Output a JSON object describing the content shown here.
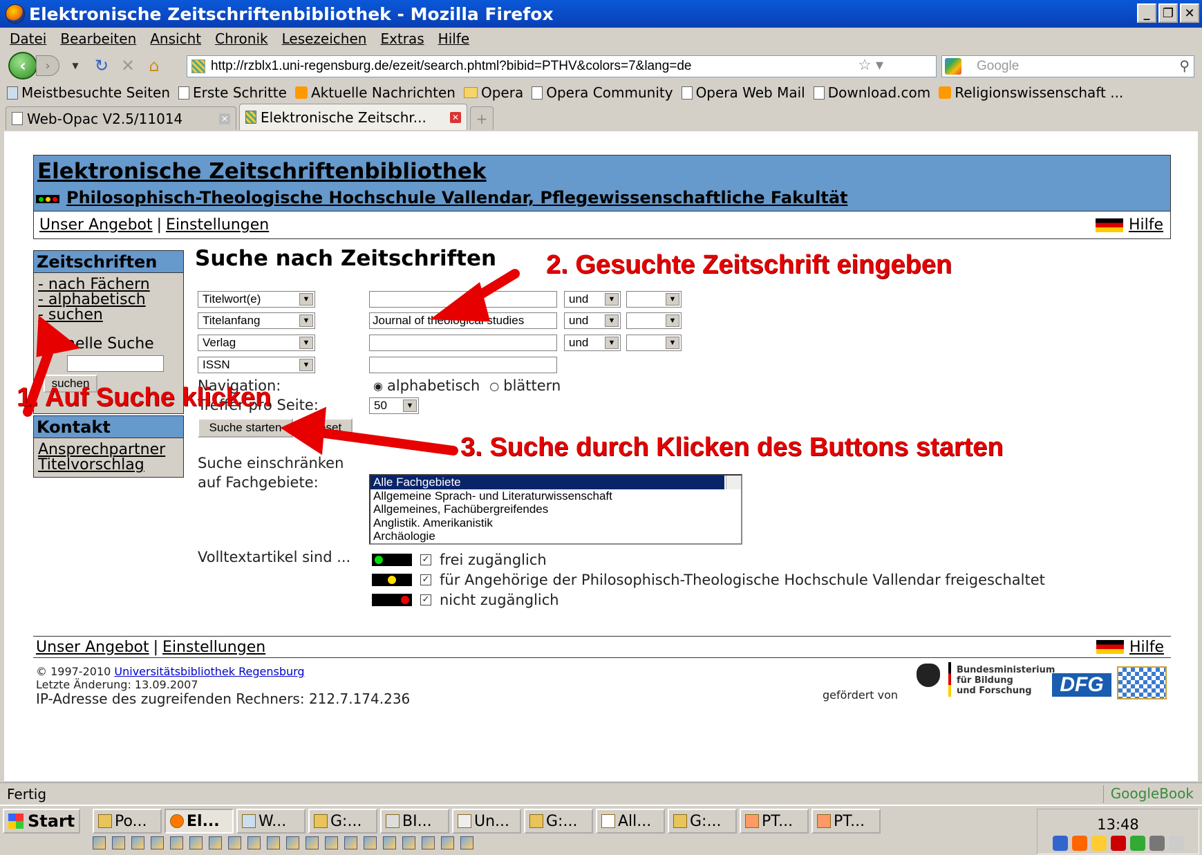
{
  "window": {
    "title": "Elektronische Zeitschriftenbibliothek - Mozilla Firefox",
    "buttons": [
      "_",
      "❐",
      "✕"
    ]
  },
  "menu": [
    "Datei",
    "Bearbeiten",
    "Ansicht",
    "Chronik",
    "Lesezeichen",
    "Extras",
    "Hilfe"
  ],
  "url": "http://rzblx1.uni-regensburg.de/ezeit/search.phtml?bibid=PTHV&colors=7&lang=de",
  "search_placeholder": "Google",
  "bookmarks": [
    "Meistbesuchte Seiten",
    "Erste Schritte",
    "Aktuelle Nachrichten",
    "Opera",
    "Opera Community",
    "Opera Web Mail",
    "Download.com",
    "Religionswissenschaft ..."
  ],
  "tabs": [
    {
      "label": "Web-Opac V2.5/11014"
    },
    {
      "label": "Elektronische Zeitschr...",
      "active": true
    }
  ],
  "page": {
    "title": "Elektronische Zeitschriftenbibliothek",
    "subtitle": "Philosophisch-Theologische Hochschule Vallendar, Pflegewissenschaftliche Fakultät",
    "nav": {
      "angebot": "Unser Angebot",
      "sep": "|",
      "einstellungen": "Einstellungen",
      "hilfe": "Hilfe"
    },
    "sidebar": {
      "header": "Zeitschriften",
      "links": [
        "- nach Fächern",
        "- alphabetisch",
        "- suchen"
      ],
      "quick_label": "Schnelle Suche",
      "quick_button": "suchen",
      "contact_header": "Kontakt",
      "contact_links": [
        "Ansprechpartner",
        "Titelvorschlag"
      ]
    },
    "heading": "Suche nach Zeitschriften",
    "rows": [
      {
        "field": "Titelwort(e)",
        "value": "",
        "op": "und"
      },
      {
        "field": "Titelanfang",
        "value": "Journal of theological studies",
        "op": "und"
      },
      {
        "field": "Verlag",
        "value": "",
        "op": "und"
      },
      {
        "field": "ISSN",
        "value": ""
      }
    ],
    "navigation_label": "Navigation:",
    "nav_options": [
      "alphabetisch",
      "blättern"
    ],
    "hits_label": "Treffer pro Seite:",
    "hits_value": "50",
    "start_button": "Suche starten",
    "reset_button": "Reset",
    "restrict_label": "Suche einschränken",
    "fach_label": "auf Fachgebiete:",
    "fach_options": [
      "Alle Fachgebiete",
      "Allgemeine Sprach- und Literaturwissenschaft",
      "Allgemeines, Fachübergreifendes",
      "Anglistik. Amerikanistik",
      "Archäologie"
    ],
    "volltext_label": "Volltextartikel sind ...",
    "access": [
      "frei zugänglich",
      "für Angehörige der Philosophisch-Theologische Hochschule Vallendar freigeschaltet",
      "nicht zugänglich"
    ],
    "footer": {
      "copyright": "© 1997-2010 ",
      "ub_link": "Universitätsbibliothek Regensburg",
      "changed": "Letzte Änderung: 13.09.2007",
      "ip": "IP-Adresse des zugreifenden Rechners: 212.7.174.236",
      "funded": "gefördert von",
      "bmbf": [
        "Bundesministerium",
        "für Bildung",
        "und Forschung"
      ],
      "dfg": "DFG"
    }
  },
  "annotations": {
    "a1": "1. Auf Suche klicken",
    "a2": "2. Gesuchte Zeitschrift eingeben",
    "a3": "3. Suche durch Klicken des Buttons starten"
  },
  "status": {
    "text": "Fertig",
    "right": "GoogleBook"
  },
  "taskbar": {
    "start": "Start",
    "items": [
      "Po...",
      "El...",
      "W...",
      "G:...",
      "BI...",
      "Un...",
      "G:...",
      "All...",
      "G:...",
      "PT...",
      "PT..."
    ],
    "clock": "13:48"
  },
  "colors": {
    "annotation": "#e60000",
    "header_bg": "#6699cc",
    "titlebar": "#0a4fcf"
  }
}
